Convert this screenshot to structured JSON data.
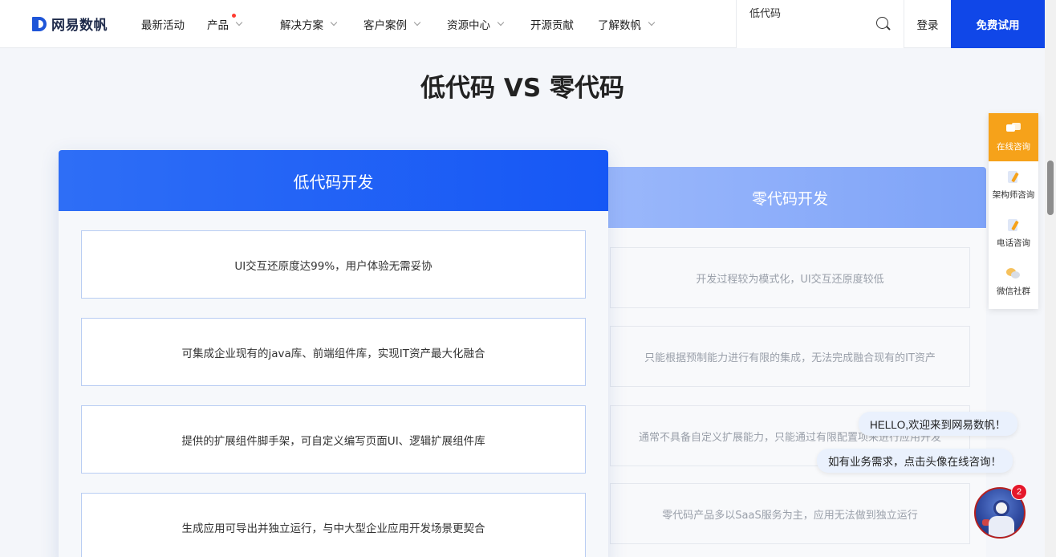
{
  "header": {
    "logo_text": "网易数帆",
    "nav": [
      {
        "label": "最新活动",
        "dropdown": false,
        "dot": false
      },
      {
        "label": "产品",
        "dropdown": true,
        "dot": true
      },
      {
        "label": "解决方案",
        "dropdown": true,
        "dot": false
      },
      {
        "label": "客户案例",
        "dropdown": true,
        "dot": false
      },
      {
        "label": "资源中心",
        "dropdown": true,
        "dot": false
      },
      {
        "label": "开源贡献",
        "dropdown": false,
        "dot": false
      },
      {
        "label": "了解数帆",
        "dropdown": true,
        "dot": false
      }
    ],
    "search_value": "低代码",
    "login_label": "登录",
    "trial_label": "免费试用"
  },
  "main": {
    "title": "低代码 VS 零代码",
    "left_card": {
      "title": "低代码开发",
      "items": [
        "UI交互还原度达99%，用户体验无需妥协",
        "可集成企业现有的java库、前端组件库，实现IT资产最大化融合",
        "提供的扩展组件脚手架，可自定义编写页面UI、逻辑扩展组件库",
        "生成应用可导出并独立运行，与中大型企业应用开发场景更契合"
      ]
    },
    "right_card": {
      "title": "零代码开发",
      "items": [
        "开发过程较为模式化，UI交互还原度较低",
        "只能根据预制能力进行有限的集成，无法完成融合现有的IT资产",
        "通常不具备自定义扩展能力，只能通过有限配置项来进行应用开发",
        "零代码产品多以SaaS服务为主，应用无法做到独立运行"
      ]
    }
  },
  "side_panel": [
    {
      "label": "在线咨询",
      "icon": "chat-icon",
      "active": true
    },
    {
      "label": "架构师咨询",
      "icon": "architect-icon",
      "active": false
    },
    {
      "label": "电话咨询",
      "icon": "phone-icon",
      "active": false
    },
    {
      "label": "微信社群",
      "icon": "wechat-icon",
      "active": false
    }
  ],
  "chat": {
    "greeting": "HELLO,欢迎来到网易数帆！",
    "prompt": "如有业务需求，点击头像在线咨询！",
    "unread_count": "2"
  },
  "colors": {
    "brand_blue": "#1047e8",
    "left_head": "#2e6ef6",
    "right_head": "#8fb0fa",
    "side_active": "#f6a21a"
  }
}
